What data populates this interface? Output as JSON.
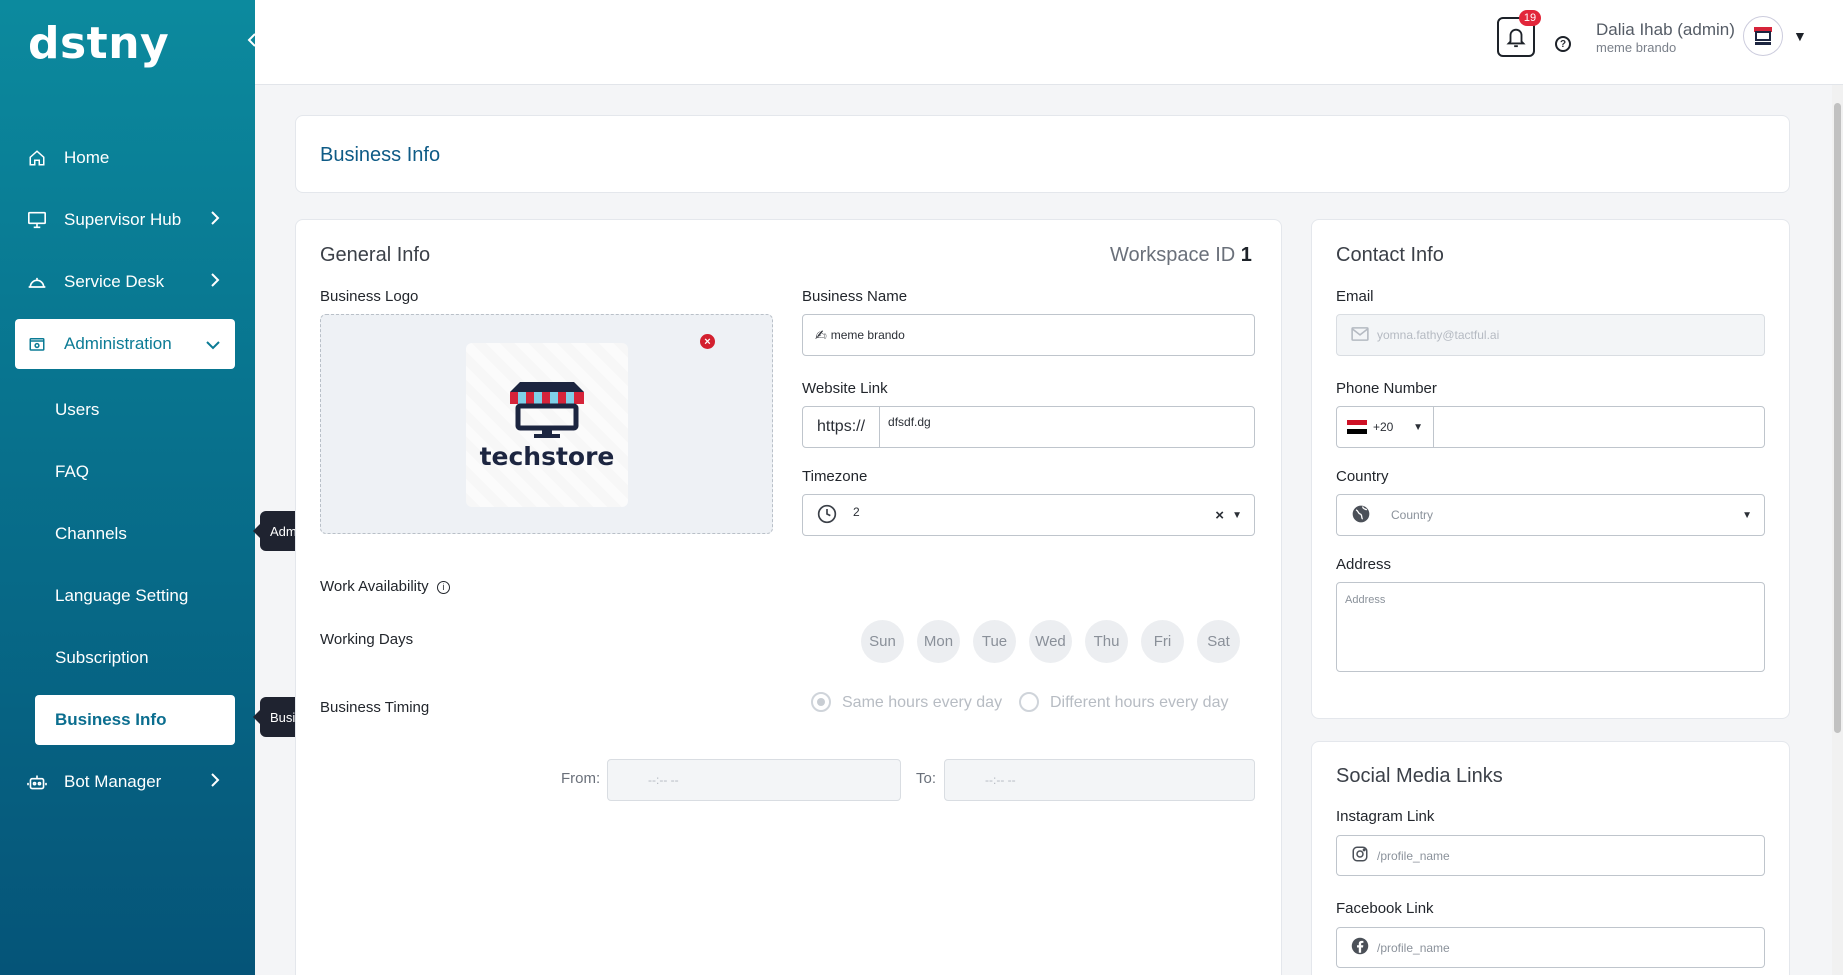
{
  "brand": {
    "logo_text": "dstny"
  },
  "sidebar": {
    "items": [
      {
        "label": "Home"
      },
      {
        "label": "Supervisor Hub"
      },
      {
        "label": "Service Desk"
      },
      {
        "label": "Administration"
      },
      {
        "label": "Bot Manager"
      }
    ],
    "admin_subitems": [
      {
        "label": "Users"
      },
      {
        "label": "FAQ"
      },
      {
        "label": "Channels"
      },
      {
        "label": "Language Setting"
      },
      {
        "label": "Subscription"
      },
      {
        "label": "Business Info"
      }
    ],
    "tooltips": {
      "administration": "Administration",
      "business_info": "Business Info"
    }
  },
  "header": {
    "notification_count": "19",
    "user_name": "Dalia Ihab (admin)",
    "user_sub": "meme brando"
  },
  "page": {
    "title": "Business Info"
  },
  "general": {
    "title": "General Info",
    "workspace_label": "Workspace ID",
    "workspace_id": "1",
    "logo_label": "Business Logo",
    "logo_brand_text": "techstore",
    "business_name_label": "Business Name",
    "business_name_value": "meme brando",
    "website_label": "Website Link",
    "website_prefix": "https://",
    "website_value": "dfsdf.dg",
    "timezone_label": "Timezone",
    "timezone_value": "2",
    "work_availability_label": "Work Availability",
    "working_days_label": "Working Days",
    "days": [
      "Sun",
      "Mon",
      "Tue",
      "Wed",
      "Thu",
      "Fri",
      "Sat"
    ],
    "business_timing_label": "Business Timing",
    "timing_options": [
      "Same hours every day",
      "Different hours every day"
    ],
    "from_label": "From:",
    "to_label": "To:",
    "time_placeholder": "--:-- --"
  },
  "contact": {
    "title": "Contact Info",
    "email_label": "Email",
    "email_value": "yomna.fathy@tactful.ai",
    "phone_label": "Phone Number",
    "phone_code": "+20",
    "country_label": "Country",
    "country_placeholder": "Country",
    "address_label": "Address",
    "address_placeholder": "Address"
  },
  "social": {
    "title": "Social Media Links",
    "instagram_label": "Instagram Link",
    "instagram_placeholder": "/profile_name",
    "facebook_label": "Facebook Link",
    "facebook_placeholder": "/profile_name"
  }
}
